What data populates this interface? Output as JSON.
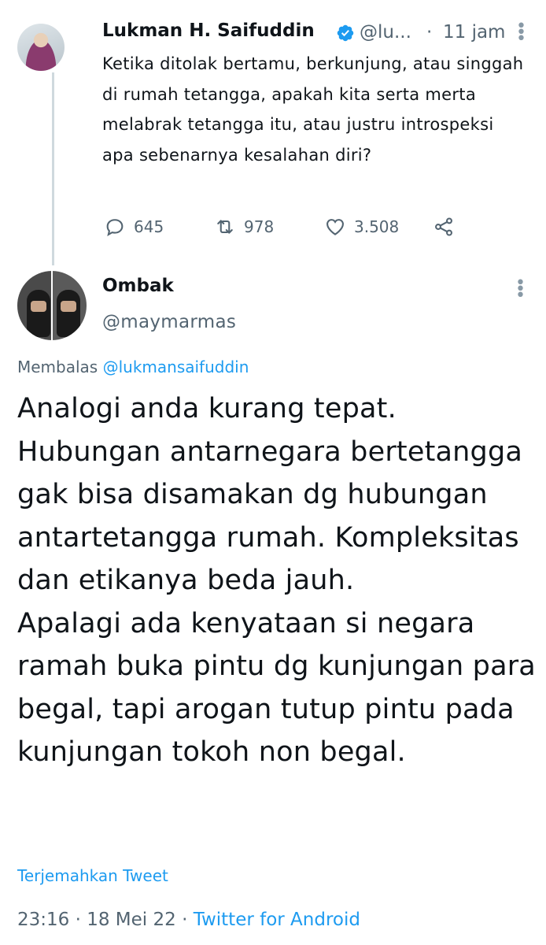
{
  "parent_tweet": {
    "name": "Lukman H. Saifuddin",
    "handle": "@lu...",
    "separator": "·",
    "time": "11 jam",
    "text": "Ketika ditolak bertamu, berkunjung, atau singgah di rumah tetangga, apakah kita serta merta melabrak tetangga itu, atau justru introspeksi apa sebenarnya kesalahan diri?",
    "replies": "645",
    "retweets": "978",
    "likes": "3.508",
    "verified": true
  },
  "reply_tweet": {
    "name": "Ombak",
    "handle": "@maymarmas",
    "replying_prefix": "Membalas",
    "replying_to": "@lukmansaifuddin",
    "text": "Analogi anda kurang tepat. Hubungan antarnegara bertetangga gak bisa disamakan dg hubungan antartetangga rumah. Kompleksitas dan etikanya beda jauh.\nApalagi ada kenyataan si negara ramah buka pintu dg kunjungan para begal, tapi arogan tutup pintu pada kunjungan tokoh non begal.",
    "translate_label": "Terjemahkan Tweet",
    "time": "23:16",
    "date": "18 Mei 22",
    "sep": "·",
    "source": "Twitter for Android"
  },
  "icons": {
    "reply": "reply-icon",
    "retweet": "retweet-icon",
    "like": "heart-icon",
    "share": "share-icon",
    "more": "more-vertical-icon",
    "verified": "verified-badge-icon"
  },
  "colors": {
    "accent": "#1d9bf0",
    "secondary_text": "#536471",
    "text": "#0f1419",
    "thread_line": "#cfd9de"
  }
}
